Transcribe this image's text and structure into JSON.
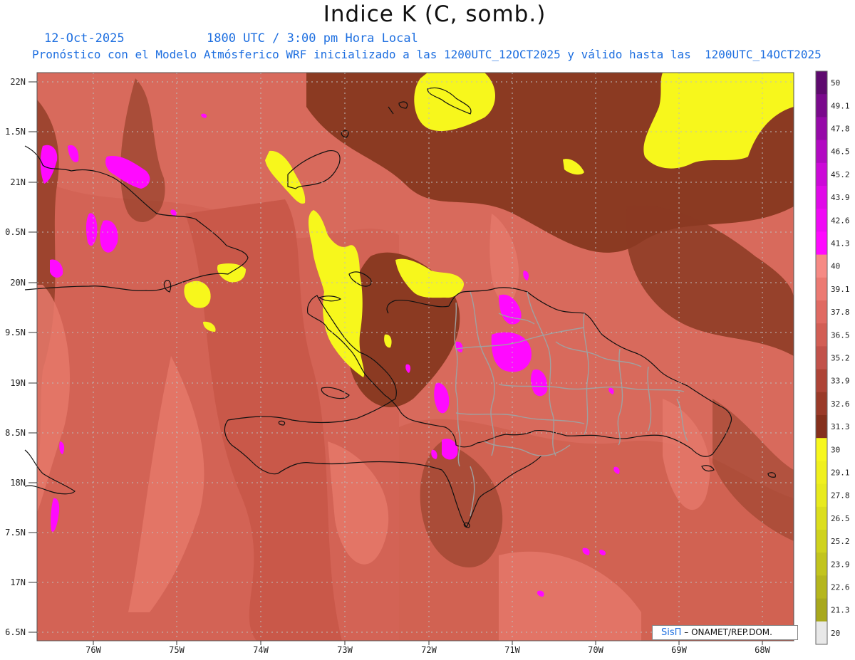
{
  "header": {
    "title": "Indice K (C, somb.)",
    "date": "12-Oct-2025",
    "time": "1800 UTC / 3:00 pm Hora Local",
    "description": "Pronóstico con el Modelo Atmósferico WRF inicializado a las 1200UTC_12OCT2025 y válido hasta las  1200UTC_14OCT2025"
  },
  "map": {
    "lat_labels": [
      "22N",
      "1.5N",
      "21N",
      "0.5N",
      "20N",
      "9.5N",
      "19N",
      "8.5N",
      "18N",
      "7.5N",
      "17N",
      "6.5N"
    ],
    "lon_labels": [
      "76W",
      "75W",
      "74W",
      "73W",
      "72W",
      "71W",
      "70W",
      "69W",
      "68W"
    ],
    "region": "Hispaniola"
  },
  "colorbar": {
    "labels": [
      "50",
      "49.1",
      "47.8",
      "46.5",
      "45.2",
      "43.9",
      "42.6",
      "41.3",
      "40",
      "39.1",
      "37.8",
      "36.5",
      "35.2",
      "33.9",
      "32.6",
      "31.3",
      "30",
      "29.1",
      "27.8",
      "26.5",
      "25.2",
      "23.9",
      "22.6",
      "21.3",
      "20"
    ],
    "colors": [
      "#5e0a6e",
      "#7a0a8c",
      "#960aa8",
      "#b20ac2",
      "#cc0ad8",
      "#e00ae8",
      "#f00af5",
      "#ff0aff",
      "#f68a84",
      "#ec7a72",
      "#e06a62",
      "#d25e54",
      "#c2524a",
      "#ae4436",
      "#9a3a28",
      "#85301c",
      "#f7f71c",
      "#f0f01c",
      "#e8ea1c",
      "#dcde1c",
      "#cfd21c",
      "#c2c41c",
      "#b5b61c",
      "#a8a81c",
      "#e8e8e8"
    ]
  },
  "credit": {
    "sis": "SisΠ",
    "text": "– ONAMET/REP.DOM."
  },
  "colors": {
    "brown": "#8b3a22",
    "salmon": "#d66658",
    "yellow": "#f7f71c",
    "magenta": "#ff0aff"
  }
}
